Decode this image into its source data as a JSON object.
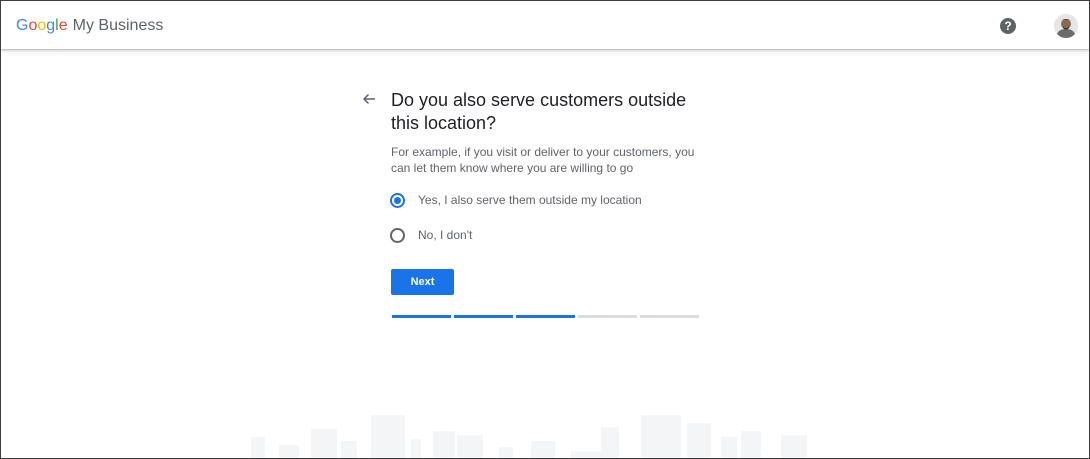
{
  "header": {
    "logo_letters": [
      "G",
      "o",
      "o",
      "g",
      "l",
      "e"
    ],
    "product_name": "My Business",
    "help_symbol": "?"
  },
  "question": {
    "title": "Do you also serve customers outside this location?",
    "subtitle": "For example, if you visit or deliver to your customers, you can let them know where you are willing to go"
  },
  "options": [
    {
      "label": "Yes, I also serve them outside my location",
      "selected": true
    },
    {
      "label": "No, I don't",
      "selected": false
    }
  ],
  "actions": {
    "next_label": "Next"
  },
  "progress": {
    "total_steps": 5,
    "completed_steps": 3
  },
  "colors": {
    "accent": "#1a73e8",
    "google_blue": "#4285f4",
    "google_red": "#ea4335",
    "google_yellow": "#fbbc05",
    "google_green": "#34a853",
    "inactive_step": "#dadce0"
  },
  "icons": {
    "back": "arrow-back-icon",
    "help": "help-icon",
    "account": "avatar"
  }
}
